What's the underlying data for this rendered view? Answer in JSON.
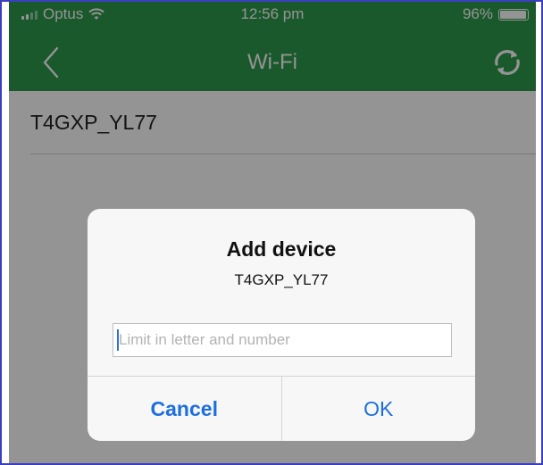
{
  "status_bar": {
    "carrier": "Optus",
    "time": "12:56 pm",
    "battery": "96%"
  },
  "nav": {
    "title": "Wi-Fi",
    "back_icon": "chevron-left-icon",
    "refresh_icon": "refresh-icon"
  },
  "list": {
    "items": [
      {
        "label": "T4GXP_YL77"
      }
    ]
  },
  "dialog": {
    "title": "Add device",
    "message": "T4GXP_YL77",
    "input_value": "",
    "input_placeholder": "Limit in letter and number",
    "cancel_label": "Cancel",
    "ok_label": "OK"
  },
  "colors": {
    "nav_background": "#2e9a4d",
    "button_text": "#1d6fe0"
  }
}
